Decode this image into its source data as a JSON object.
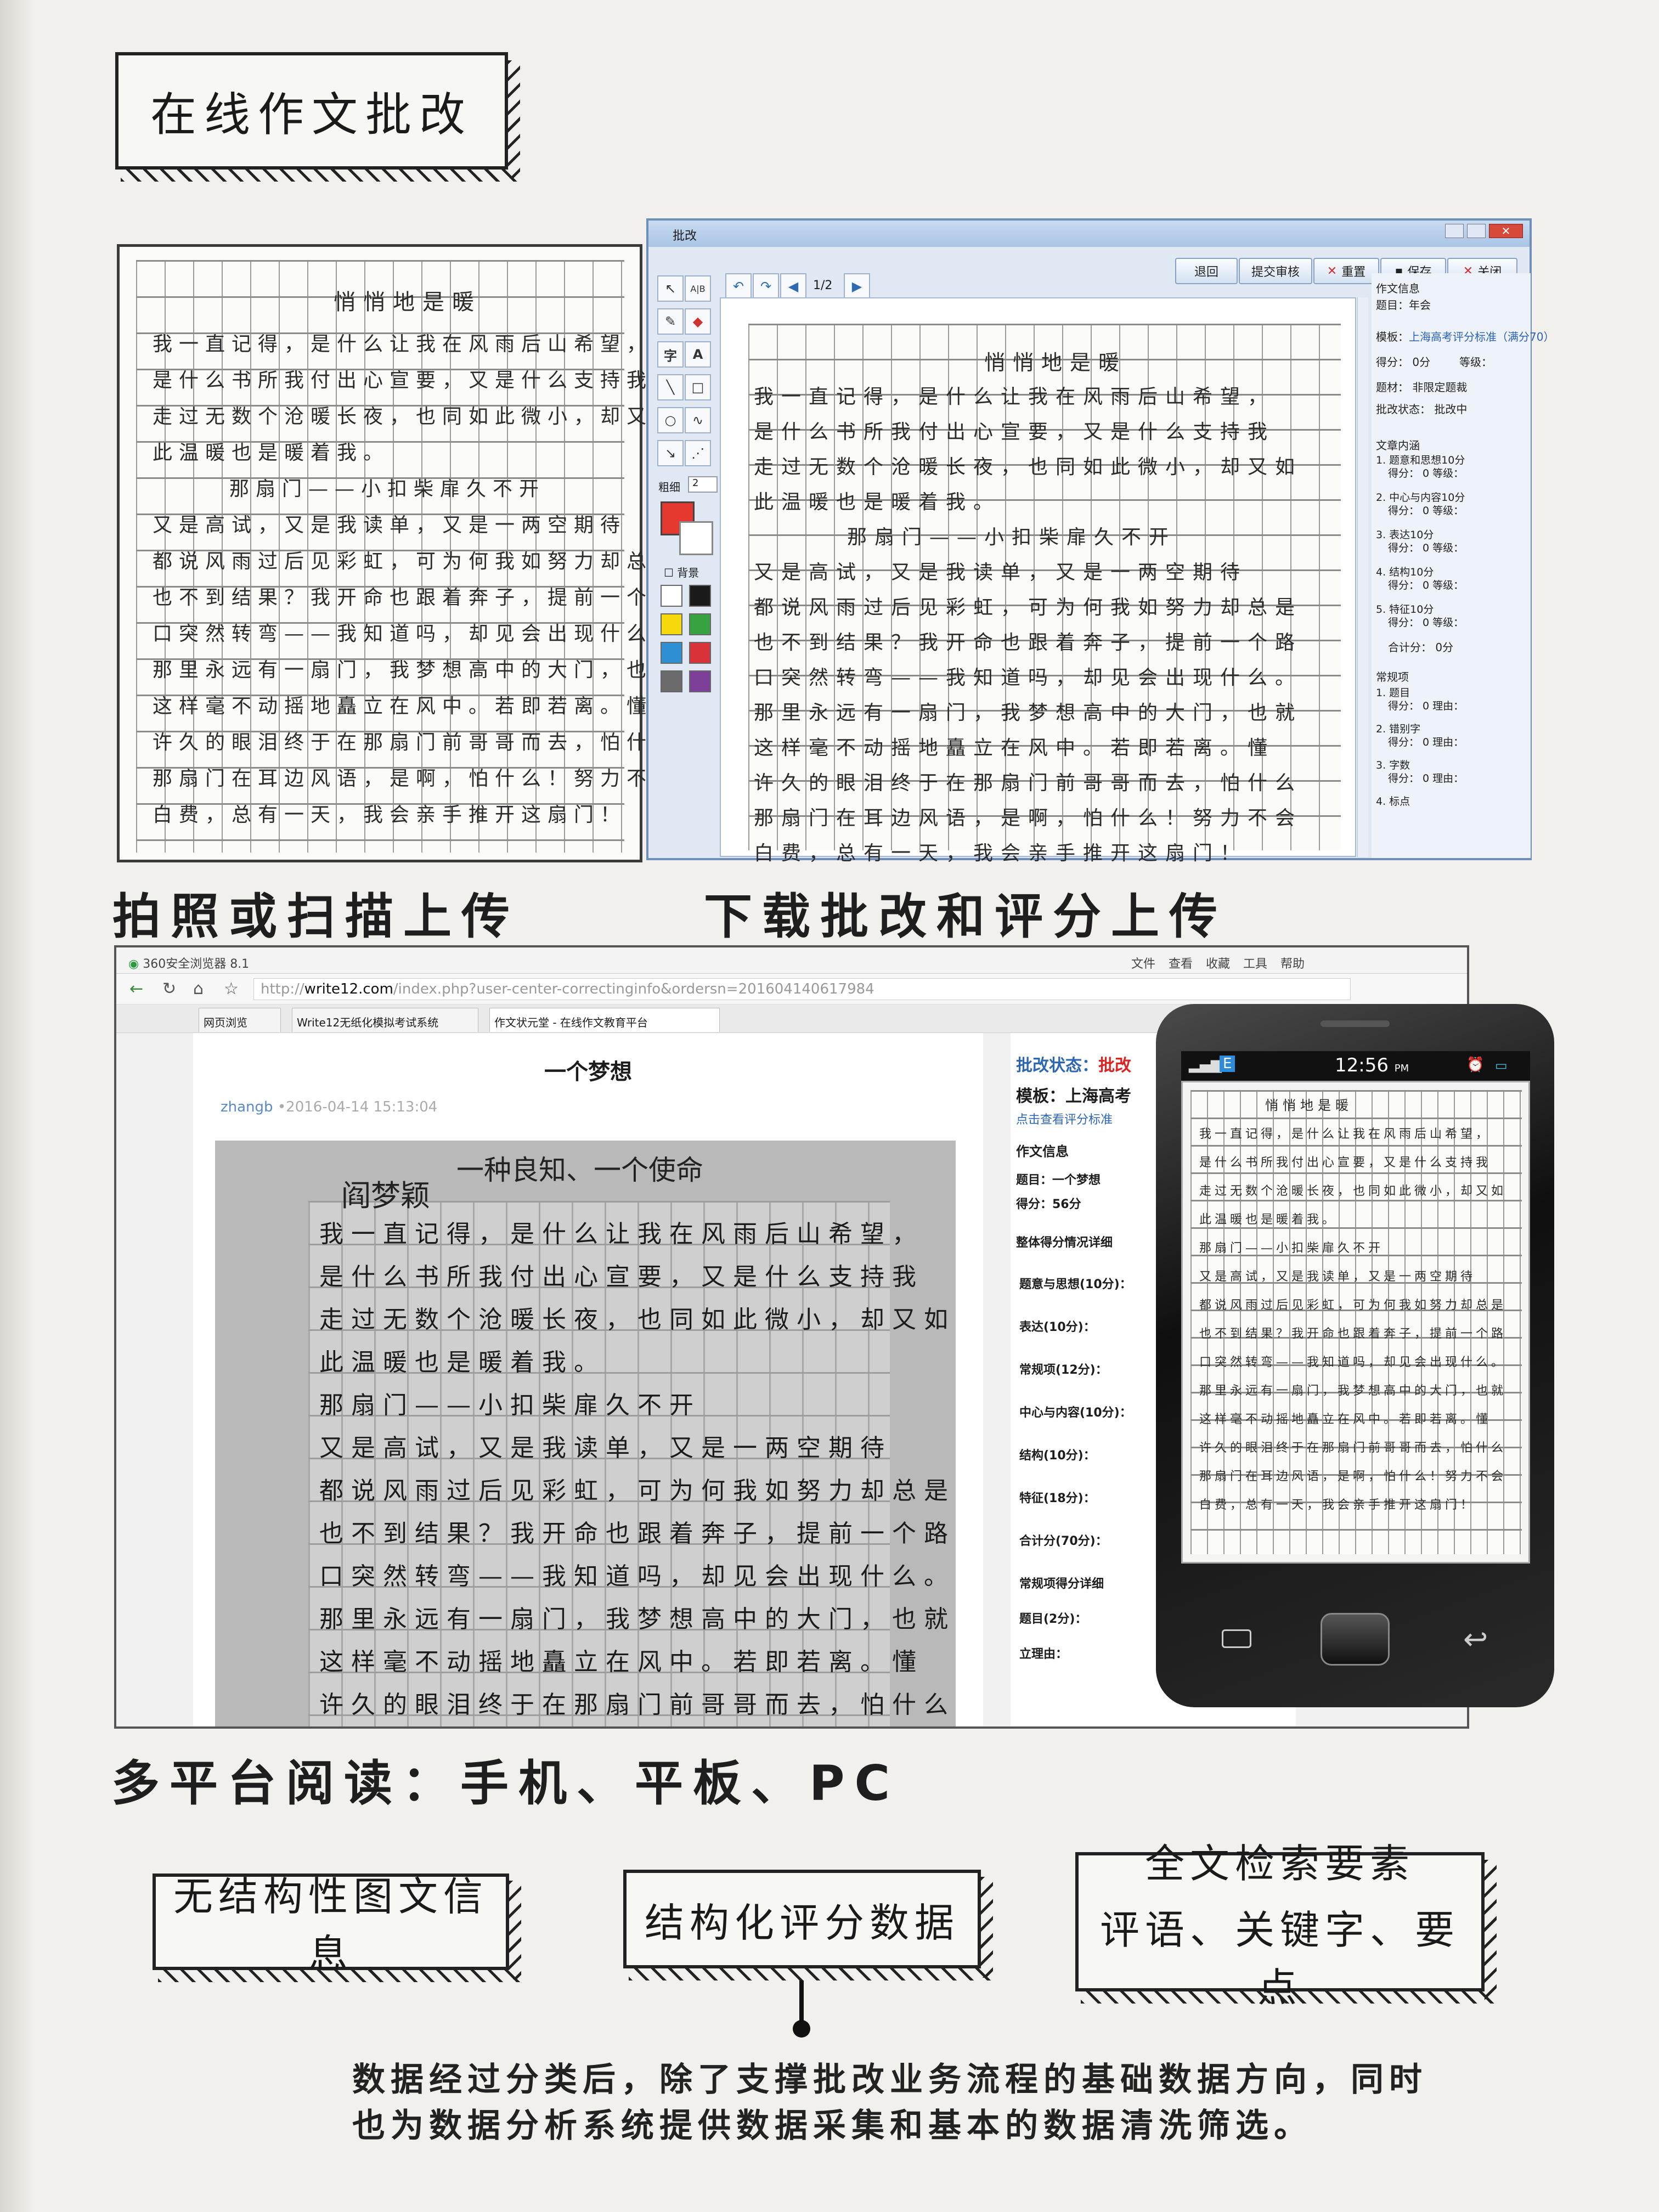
{
  "title": "在线作文批改",
  "captions": {
    "upload": "拍照或扫描上传",
    "download": "下载批改和评分上传",
    "platforms": "多平台阅读：手机、平板、PC"
  },
  "essay": {
    "title": "悄悄地是暖",
    "lines": [
      "我一直记得，是什么让我在风雨后山希望，",
      "是什么书所我付出心宣要，又是什么支持我",
      "走过无数个沧暖长夜，也同如此微小，却又如",
      "此温暖也是暖着我。",
      "那扇门——小扣柴扉久不开",
      "又是高试，又是我读单，又是一两空期待",
      "都说风雨过后见彩虹，可为何我如努力却总是",
      "也不到结果？我开命也跟着奔子，提前一个路",
      "口突然转弯——我知道吗，却见会出现什么。",
      "那里永远有一扇门，我梦想高中的大门，也就",
      "这样毫不动摇地矗立在风中。若即若离。懂",
      "许久的眼泪终于在那扇门前哥哥而去，怕什么",
      "那扇门在耳边风语，是啊，怕什么！努力不会",
      "白费，总有一天，我会亲手推开这扇门！"
    ]
  },
  "software": {
    "window_title": "批改",
    "page_indicator": "1/2",
    "toolbar_buttons": [
      "退回",
      "提交审核",
      "重置",
      "保存",
      "关闭"
    ],
    "tool_labels": [
      "字",
      "A",
      "粗细",
      "2",
      "背景"
    ],
    "colors": [
      "#e5392f",
      "#ffffff",
      "#ffffff",
      "#1a1a1a",
      "#f5d90a",
      "#37a340",
      "#2f8fd3",
      "#d8323a",
      "#6b6b6b",
      "#7d3f99"
    ],
    "panel": {
      "section_info": "作文信息",
      "topic": "题目：年会",
      "template_label": "模板：",
      "template_value": "上海高考评分标准（满分70）",
      "score": "得分：   0分",
      "grade": "等级：",
      "material": "题材：  非限定题裁",
      "status": "批改状态：  批改中",
      "section_content": "文章内涵",
      "items": [
        "1. 题意和思想10分",
        "2. 中心与内容10分",
        "3. 表达10分",
        "4. 结构10分",
        "5. 特征10分"
      ],
      "item_sub": "得分：  0     等级：",
      "total": "合计分：        0分",
      "section_common": "常规项",
      "common_items": [
        "1. 题目",
        "2. 错别字",
        "3. 字数",
        "4. 标点"
      ],
      "common_sub": "得分：  0     理由："
    }
  },
  "browser": {
    "app_name": "360安全浏览器 8.1",
    "menu": [
      "文件",
      "查看",
      "收藏",
      "工具",
      "帮助"
    ],
    "url_host": "write12.com",
    "url_prefix": "http://",
    "url_rest": "/index.php?user-center-correctinginfo&ordersn=201604140617984",
    "tabs": [
      "网页浏览",
      "Write12无纸化模拟考试系统",
      "作文状元堂 - 在线作文教育平台"
    ],
    "essay_title": "一个梦想",
    "author": "zhangb",
    "date": "•2016-04-14 15:13:04",
    "scan_title": "一种良知、一个使命",
    "scan_name": "阎梦颖",
    "side": {
      "status_label": "批改状态：",
      "status_value": "批改",
      "template": "模板：上海高考",
      "view_standard": "点击查看评分标准",
      "info": "作文信息",
      "topic": "题目：一个梦想",
      "score": "得分：56分",
      "detail": "整体得分情况详细",
      "items": [
        "题意与思想(10分)：",
        "表达(10分)：",
        "常规项(12分)：",
        "中心与内容(10分)：",
        "结构(10分)：",
        "特征(18分)：",
        "合计分(70分)：",
        "常规项得分详细",
        "题目(2分)：",
        "立理由："
      ]
    }
  },
  "phone": {
    "time": "12:56",
    "ampm": "PM",
    "essay_title": "悄悄地是暖"
  },
  "boxes": {
    "unstructured": "无结构性图文信息",
    "structured": "结构化评分数据",
    "fulltext_line1": "全文检索要素",
    "fulltext_line2": "评语、关键字、要点"
  },
  "footer": {
    "line1": "数据经过分类后，除了支撑批改业务流程的基础数据方向，同时",
    "line2": "也为数据分析系统提供数据采集和基本的数据清洗筛选。"
  }
}
